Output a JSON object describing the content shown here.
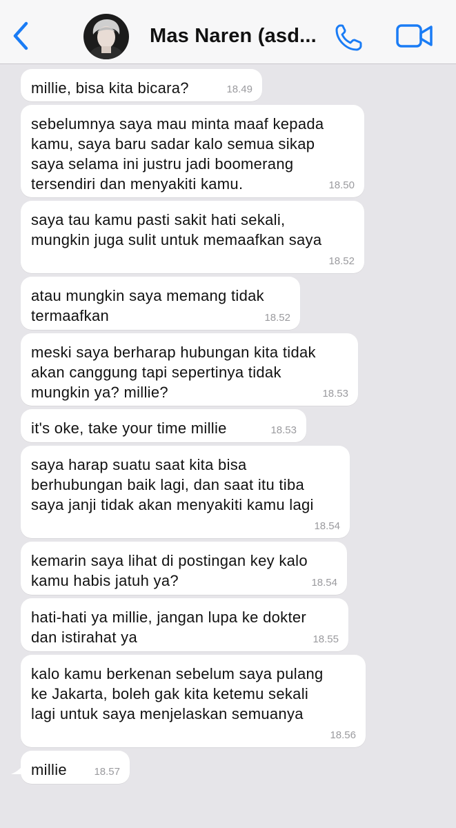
{
  "header": {
    "contact_name": "Mas Naren (asd...",
    "icons": {
      "back": "chevron-left-icon",
      "avatar": "avatar",
      "call": "phone-icon",
      "video": "video-camera-icon"
    },
    "accent_color": "#1a7cf5"
  },
  "messages": [
    {
      "text": "millie, bisa kita bicara?",
      "time": "18.49"
    },
    {
      "text": "sebelumnya saya mau minta maaf kepada\nkamu, saya baru sadar kalo semua sikap\nsaya selama ini justru jadi boomerang\ntersendiri dan menyakiti kamu.",
      "time": "18.50"
    },
    {
      "text": "saya tau kamu pasti sakit hati sekali,\nmungkin juga sulit untuk memaafkan saya",
      "time": "18.52"
    },
    {
      "text": "atau mungkin saya memang tidak\ntermaafkan",
      "time": "18.52"
    },
    {
      "text": "meski saya berharap hubungan kita tidak\nakan canggung tapi sepertinya tidak\nmungkin ya? millie?",
      "time": "18.53"
    },
    {
      "text": "it's oke, take your time millie",
      "time": "18.53"
    },
    {
      "text": "saya harap suatu saat kita bisa\nberhubungan baik lagi, dan saat itu tiba\nsaya janji tidak akan menyakiti kamu lagi",
      "time": "18.54"
    },
    {
      "text": "kemarin saya lihat di postingan key kalo\nkamu habis jatuh ya?",
      "time": "18.54"
    },
    {
      "text": "hati-hati ya millie, jangan lupa ke dokter\ndan istirahat ya",
      "time": "18.55"
    },
    {
      "text": "kalo kamu berkenan sebelum saya pulang\nke Jakarta, boleh gak kita ketemu sekali\nlagi untuk saya menjelaskan semuanya",
      "time": "18.56"
    },
    {
      "text": "millie",
      "time": "18.57"
    }
  ]
}
